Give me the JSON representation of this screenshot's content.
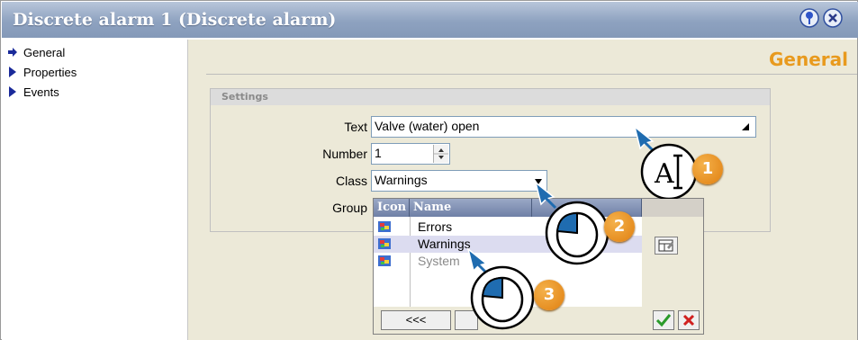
{
  "window": {
    "title": "Discrete alarm 1 (Discrete alarm)",
    "help_icon": "help-pin-icon",
    "close_icon": "close-icon"
  },
  "nav": {
    "items": [
      {
        "label": "General",
        "icon": "arrow-right-icon"
      },
      {
        "label": "Properties",
        "icon": "triangle-right-icon"
      },
      {
        "label": "Events",
        "icon": "triangle-right-icon"
      }
    ]
  },
  "main": {
    "heading": "General",
    "settings": {
      "title": "Settings",
      "text_label": "Text",
      "text_value": "Valve (water) open",
      "number_label": "Number",
      "number_value": "1",
      "class_label": "Class",
      "class_value": "Warnings",
      "group_label": "Group"
    }
  },
  "class_popup": {
    "columns": [
      "Icon",
      "Name"
    ],
    "rows": [
      "Errors",
      "Warnings",
      "System"
    ],
    "selected": "Warnings",
    "back_button": "<<<",
    "ok_icon": "checkmark-icon",
    "cancel_icon": "red-x-icon"
  },
  "callouts": [
    "1",
    "2",
    "3"
  ],
  "colors": {
    "title_bar": "#8ea2c0",
    "heading": "#e89a1e",
    "popup_header": "#6f80a6",
    "selection": "#dcdcf0",
    "badge": "#e8901a",
    "cursor_blue": "#1f6cb0"
  }
}
